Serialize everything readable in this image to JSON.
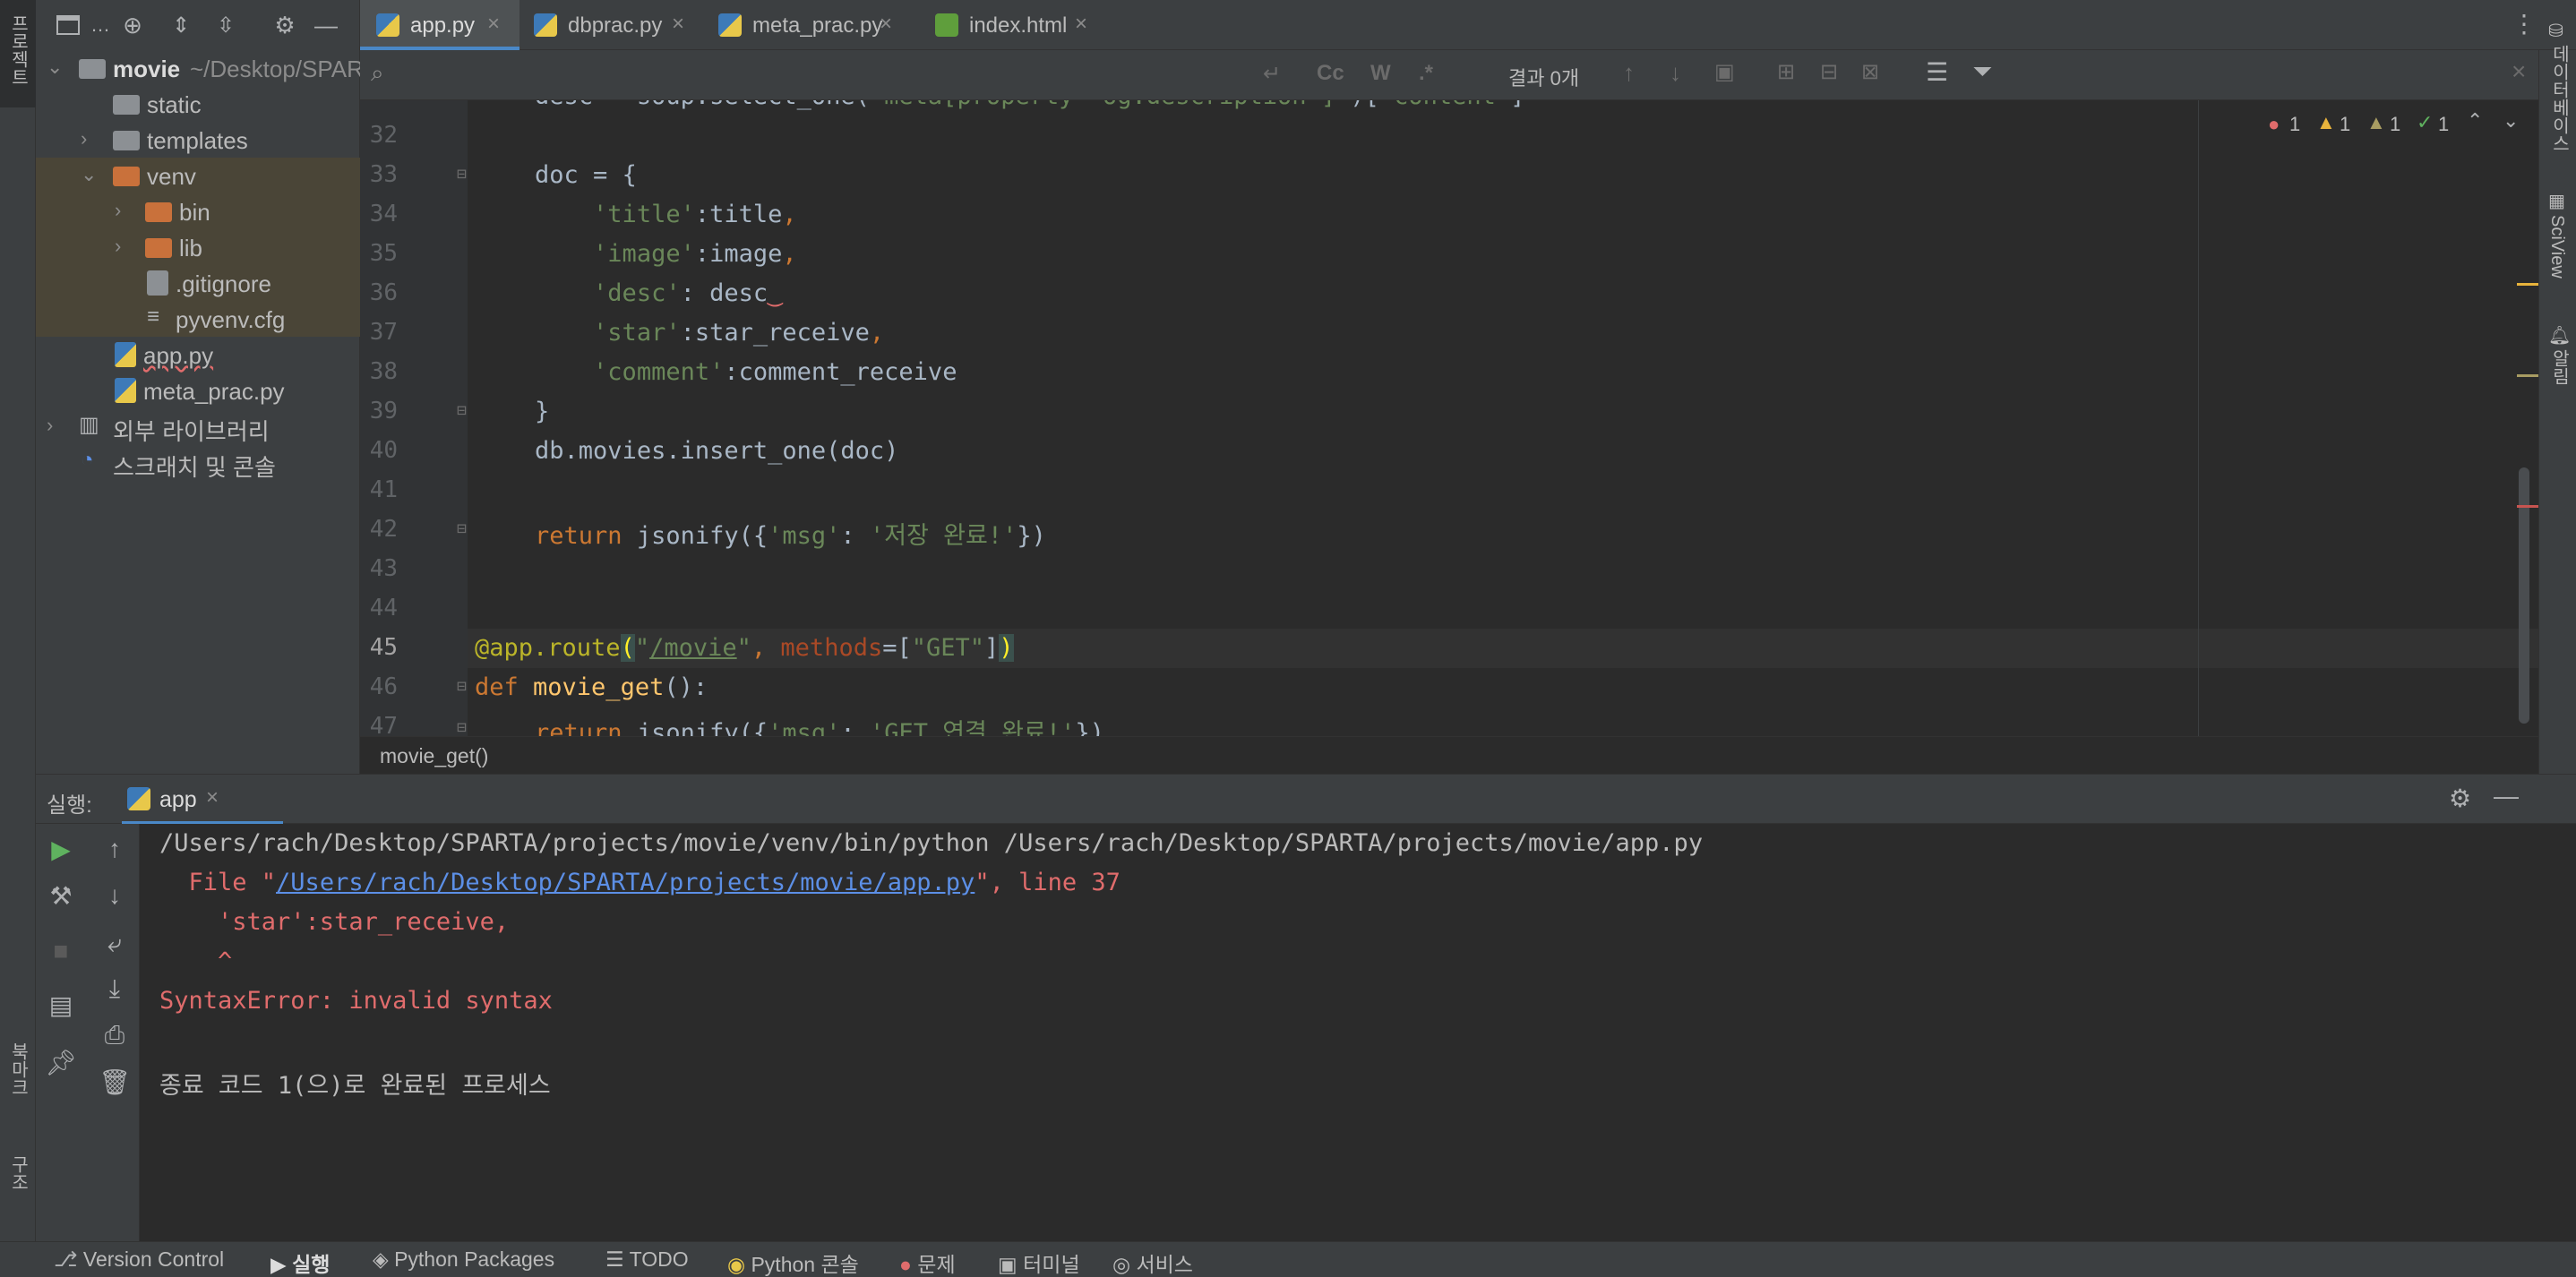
{
  "left_strip": {
    "project_label": "프로젝트",
    "bookmarks_label": "북마크",
    "structure_label": "구조"
  },
  "project_tree": [
    {
      "label": "movie",
      "suffix": "~/Desktop/SPAR",
      "kind": "root"
    },
    {
      "label": "static",
      "kind": "folder"
    },
    {
      "label": "templates",
      "kind": "folder"
    },
    {
      "label": "venv",
      "kind": "folder-excluded"
    },
    {
      "label": "bin",
      "kind": "folder-excluded"
    },
    {
      "label": "lib",
      "kind": "folder-excluded"
    },
    {
      "label": ".gitignore",
      "kind": "file"
    },
    {
      "label": "pyvenv.cfg",
      "kind": "file"
    },
    {
      "label": "app.py",
      "kind": "python-file"
    },
    {
      "label": "meta_prac.py",
      "kind": "python-file"
    },
    {
      "label": "외부 라이브러리",
      "kind": "library"
    },
    {
      "label": "스크래치 및 콘솔",
      "kind": "scratch"
    }
  ],
  "tabs": [
    {
      "label": "app.py",
      "active": true
    },
    {
      "label": "dbprac.py",
      "active": false
    },
    {
      "label": "meta_prac.py",
      "active": false
    },
    {
      "label": "index.html",
      "active": false
    }
  ],
  "search": {
    "placeholder": "",
    "results": "결과 0개",
    "match_case": "Cc",
    "words": "W",
    "regex": ".*"
  },
  "inspections": {
    "errors": "1",
    "warnings": "1",
    "weak_warnings": "1",
    "ok": "1"
  },
  "editor": {
    "line_numbers": [
      "32",
      "33",
      "34",
      "35",
      "36",
      "37",
      "38",
      "39",
      "40",
      "41",
      "42",
      "43",
      "44",
      "45",
      "46",
      "47"
    ],
    "breadcrumb": "movie_get()"
  },
  "run": {
    "label": "실행:",
    "tab_label": "app",
    "output": {
      "command": "/Users/rach/Desktop/SPARTA/projects/movie/venv/bin/python /Users/rach/Desktop/SPARTA/projects/movie/app.py",
      "file_prefix": "  File \"",
      "file_link": "/Users/rach/Desktop/SPARTA/projects/movie/app.py",
      "file_suffix": "\", line 37",
      "code_line": "    'star':star_receive,",
      "caret": "    ^",
      "error": "SyntaxError: invalid syntax",
      "exit": "종료 코드 1(으)로 완료된 프로세스"
    }
  },
  "right_strip": {
    "database_label": "데이터베이스",
    "sciview_label": "SciView",
    "notifications_label": "알림"
  },
  "statusbar": {
    "version_control": "Version Control",
    "run": "실행",
    "python_packages": "Python Packages",
    "todo": "TODO",
    "python_console": "Python 콘솔",
    "problems": "문제",
    "terminal": "터미널",
    "services": "서비스"
  },
  "colors": {
    "keyword": "#cc7832",
    "string": "#6a8759",
    "function": "#ffc66d",
    "decorator": "#bbb529",
    "error": "#e06c6c",
    "link": "#5c8fe6",
    "excluded_folder_bg": "#4a4537"
  }
}
